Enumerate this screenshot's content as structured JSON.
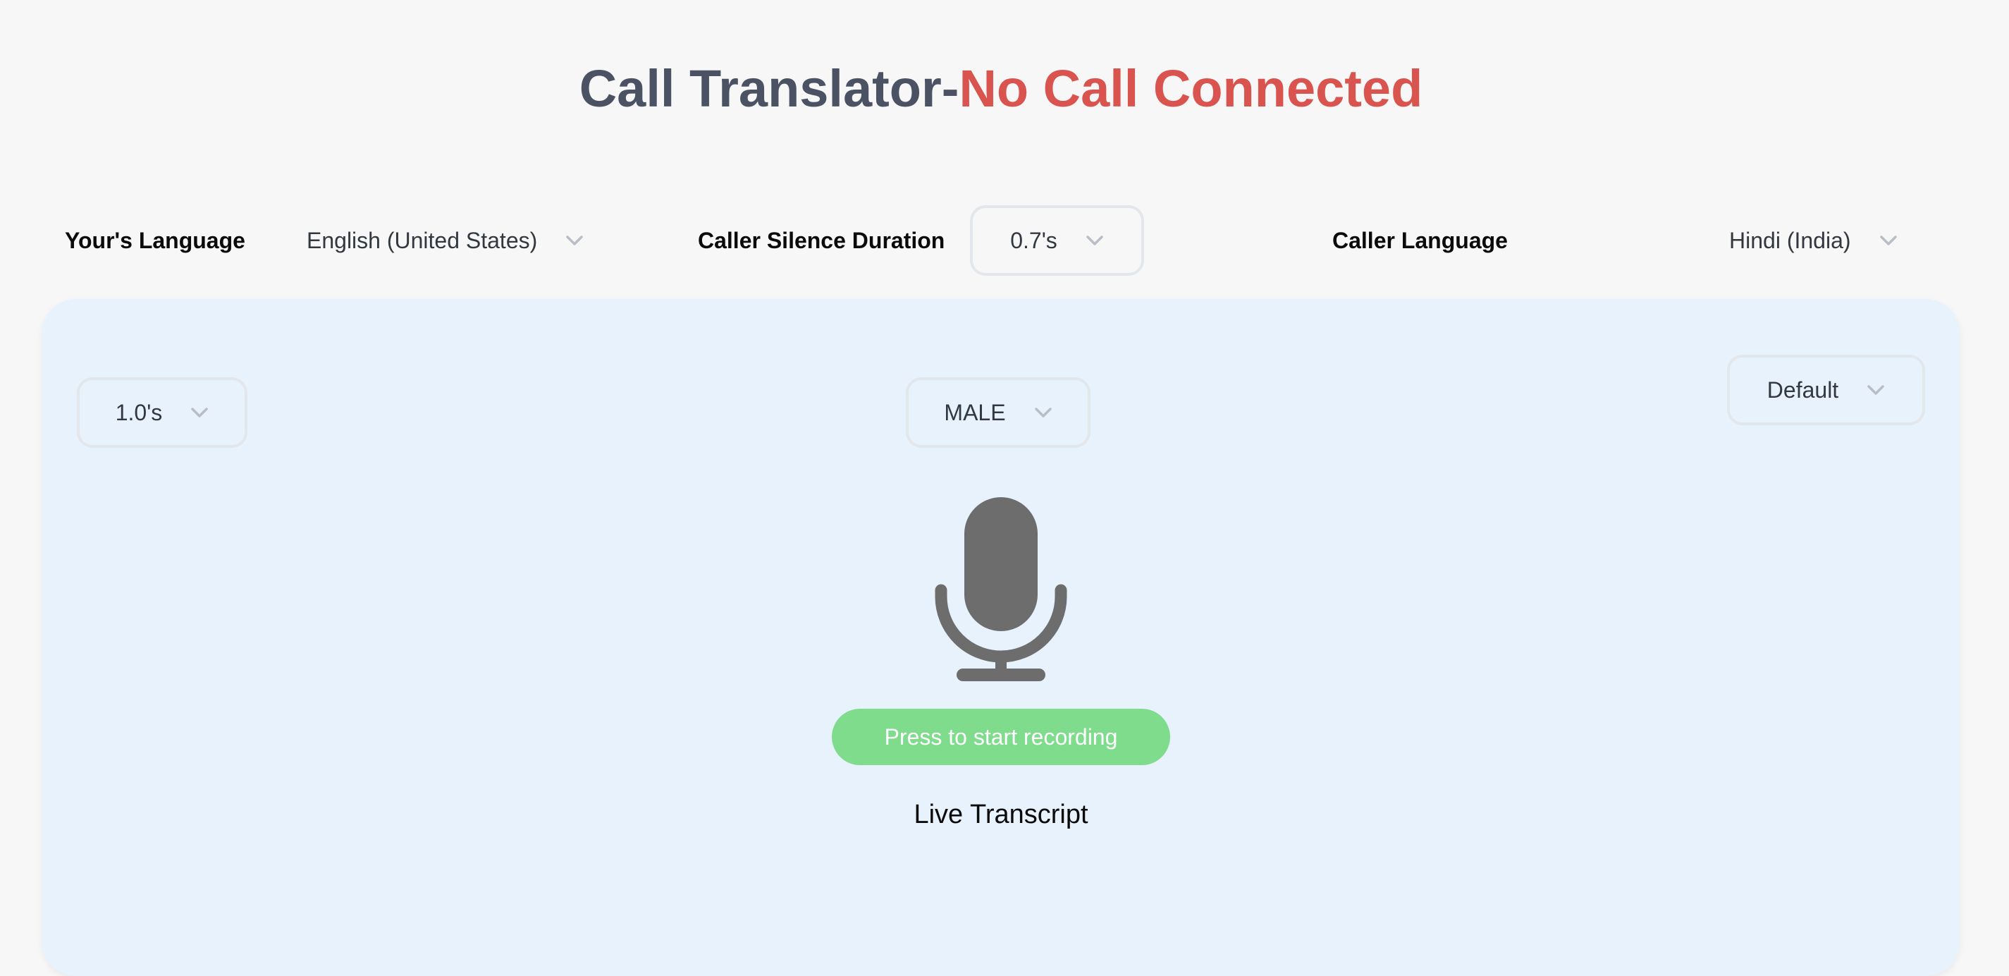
{
  "header": {
    "app_title": "Call Translator-",
    "status_text": "No Call Connected",
    "status_color": "#d9534f"
  },
  "settings": {
    "your_language": {
      "label": "Your's Language",
      "value": "English (United States)"
    },
    "caller_silence_duration": {
      "label": "Caller Silence Duration",
      "value": "0.7's"
    },
    "caller_language": {
      "label": "Caller Language",
      "value": "Hindi (India)"
    }
  },
  "panel": {
    "silence_duration_value": "1.0's",
    "voice_gender_value": "MALE",
    "voice_value": "Default",
    "mic_icon": "microphone-icon",
    "record_button_label": "Press to start recording",
    "record_button_color": "#7fdc8d",
    "transcript_heading": "Live Transcript"
  }
}
